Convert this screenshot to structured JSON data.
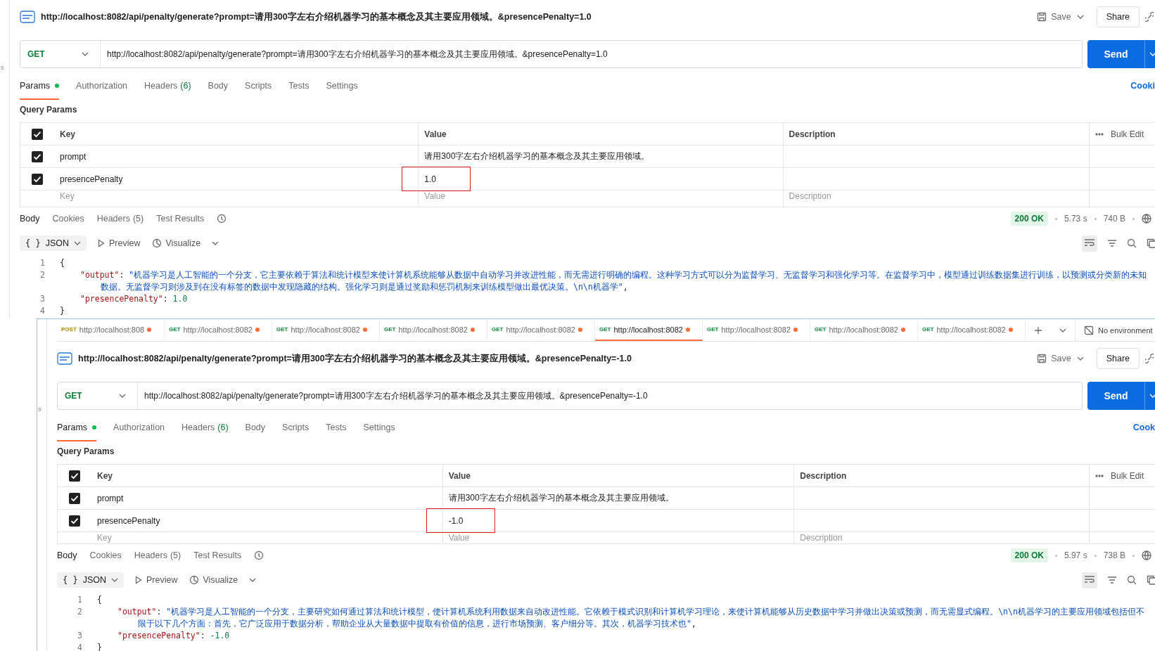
{
  "panels": [
    {
      "edge_text": "s",
      "title": "http://localhost:8082/api/penalty/generate?prompt=请用300字左右介绍机器学习的基本概念及其主要应用领域。&presencePenalty=1.0",
      "save_label": "Save",
      "share_label": "Share",
      "method": "GET",
      "url": "http://localhost:8082/api/penalty/generate?prompt=请用300字左右介绍机器学习的基本概念及其主要应用领域。&presencePenalty=1.0",
      "send_label": "Send",
      "request_tabs": [
        {
          "label": "Params",
          "selected": true,
          "dot": true
        },
        {
          "label": "Authorization",
          "selected": false,
          "dot": false
        },
        {
          "label": "Headers",
          "count": "(6)",
          "selected": false,
          "dot": false
        },
        {
          "label": "Body",
          "selected": false,
          "dot": false
        },
        {
          "label": "Scripts",
          "selected": false,
          "dot": false
        },
        {
          "label": "Tests",
          "selected": false,
          "dot": false
        },
        {
          "label": "Settings",
          "selected": false,
          "dot": false
        }
      ],
      "cookies_link": "Cooki",
      "query_params_label": "Query Params",
      "all_checked": true,
      "columns": [
        "Key",
        "Value",
        "Description"
      ],
      "bulk_edit": "Bulk Edit",
      "params": [
        {
          "checked": true,
          "key": "prompt",
          "value": "请用300字左右介绍机器学习的基本概念及其主要应用领域。",
          "highlighted": false
        },
        {
          "checked": true,
          "key": "presencePenalty",
          "value": "1.0",
          "highlighted": true
        }
      ],
      "placeholder_row": {
        "key": "Key",
        "value": "Value",
        "description": "Description"
      },
      "response_tabs": [
        {
          "label": "Body",
          "selected": true
        },
        {
          "label": "Cookies",
          "selected": false
        },
        {
          "label": "Headers",
          "count": "(5)",
          "selected": false
        },
        {
          "label": "Test Results",
          "selected": false
        }
      ],
      "status": "200 OK",
      "time": "5.73 s",
      "size": "740 B",
      "format_icon": "{ }",
      "format": "JSON",
      "preview_label": "Preview",
      "visualize_label": "Visualize",
      "code_lines": [
        {
          "number": "1",
          "indented": false,
          "tokens": [
            {
              "kind": "punct",
              "text": "{"
            }
          ]
        },
        {
          "number": "2",
          "indented": true,
          "tokens": [
            {
              "kind": "key",
              "text": "\"output\""
            },
            {
              "kind": "punct",
              "text": ": "
            },
            {
              "kind": "string",
              "text": "\"机器学习是人工智能的一个分支，它主要依赖于算法和统计模型来使计算机系统能够从数据中自动学习并改进性能，而无需进行明确的编程。这种学习方式可以分为监督学习、无监督学习和强化学习等。在监督学习中，模型通过训练数据集进行训练，以预测或分类新的未知数据。无监督学习则涉及到在没有标签的数据中发现隐藏的结构。强化学习则是通过奖励和惩罚机制来训练模型做出最优决策。\\n\\n机器学\""
            },
            {
              "kind": "punct",
              "text": ","
            }
          ]
        },
        {
          "number": "3",
          "indented": true,
          "tokens": [
            {
              "kind": "key",
              "text": "\"presencePenalty\""
            },
            {
              "kind": "punct",
              "text": ": "
            },
            {
              "kind": "number",
              "text": "1.0"
            }
          ]
        },
        {
          "number": "4",
          "indented": false,
          "tokens": [
            {
              "kind": "punct",
              "text": "}"
            }
          ]
        }
      ]
    },
    {
      "edge_text": "s",
      "tab_strip": {
        "tabs": [
          {
            "method": "POST",
            "color": "#b7860b",
            "url": "http://localhost:808",
            "modified": true,
            "selected": false
          },
          {
            "method": "GET",
            "color": "#0f8a3c",
            "url": "http://localhost:8082",
            "modified": true,
            "selected": false
          },
          {
            "method": "GET",
            "color": "#0f8a3c",
            "url": "http://localhost:8082",
            "modified": true,
            "selected": false
          },
          {
            "method": "GET",
            "color": "#0f8a3c",
            "url": "http://localhost:8082",
            "modified": true,
            "selected": false
          },
          {
            "method": "GET",
            "color": "#0f8a3c",
            "url": "http://localhost:8082",
            "modified": true,
            "selected": false
          },
          {
            "method": "GET",
            "color": "#0f8a3c",
            "url": "http://localhost:8082",
            "modified": true,
            "selected": true
          },
          {
            "method": "GET",
            "color": "#0f8a3c",
            "url": "http://localhost:8082",
            "modified": true,
            "selected": false
          },
          {
            "method": "GET",
            "color": "#0f8a3c",
            "url": "http://localhost:8082",
            "modified": true,
            "selected": false
          },
          {
            "method": "GET",
            "color": "#0f8a3c",
            "url": "http://localhost:8082",
            "modified": true,
            "selected": false
          }
        ],
        "environment": "No environment"
      },
      "title": "http://localhost:8082/api/penalty/generate?prompt=请用300字左右介绍机器学习的基本概念及其主要应用领域。&presencePenalty=-1.0",
      "save_label": "Save",
      "share_label": "Share",
      "method": "GET",
      "url": "http://localhost:8082/api/penalty/generate?prompt=请用300字左右介绍机器学习的基本概念及其主要应用领域。&presencePenalty=-1.0",
      "send_label": "Send",
      "request_tabs": [
        {
          "label": "Params",
          "selected": true,
          "dot": true
        },
        {
          "label": "Authorization",
          "selected": false,
          "dot": false
        },
        {
          "label": "Headers",
          "count": "(6)",
          "selected": false,
          "dot": false
        },
        {
          "label": "Body",
          "selected": false,
          "dot": false
        },
        {
          "label": "Scripts",
          "selected": false,
          "dot": false
        },
        {
          "label": "Tests",
          "selected": false,
          "dot": false
        },
        {
          "label": "Settings",
          "selected": false,
          "dot": false
        }
      ],
      "cookies_link": "Cook",
      "query_params_label": "Query Params",
      "all_checked": true,
      "columns": [
        "Key",
        "Value",
        "Description"
      ],
      "bulk_edit": "Bulk Edit",
      "params": [
        {
          "checked": true,
          "key": "prompt",
          "value": "请用300字左右介绍机器学习的基本概念及其主要应用领域。",
          "highlighted": false
        },
        {
          "checked": true,
          "key": "presencePenalty",
          "value": "-1.0",
          "highlighted": true
        }
      ],
      "placeholder_row": {
        "key": "Key",
        "value": "Value",
        "description": "Description"
      },
      "response_tabs": [
        {
          "label": "Body",
          "selected": true
        },
        {
          "label": "Cookies",
          "selected": false
        },
        {
          "label": "Headers",
          "count": "(5)",
          "selected": false
        },
        {
          "label": "Test Results",
          "selected": false
        }
      ],
      "status": "200 OK",
      "time": "5.97 s",
      "size": "738 B",
      "format_icon": "{ }",
      "format": "JSON",
      "preview_label": "Preview",
      "visualize_label": "Visualize",
      "code_lines": [
        {
          "number": "1",
          "indented": false,
          "tokens": [
            {
              "kind": "punct",
              "text": "{"
            }
          ]
        },
        {
          "number": "2",
          "indented": true,
          "tokens": [
            {
              "kind": "key",
              "text": "\"output\""
            },
            {
              "kind": "punct",
              "text": ": "
            },
            {
              "kind": "string",
              "text": "\"机器学习是人工智能的一个分支，主要研究如何通过算法和统计模型，使计算机系统利用数据来自动改进性能。它依赖于模式识别和计算机学习理论，来使计算机能够从历史数据中学习并做出决策或预测，而无需显式编程。\\n\\n机器学习的主要应用领域包括但不限于以下几个方面：首先，它广泛应用于数据分析，帮助企业从大量数据中提取有价值的信息，进行市场预测、客户细分等。其次，机器学习技术也\""
            },
            {
              "kind": "punct",
              "text": ","
            }
          ]
        },
        {
          "number": "3",
          "indented": true,
          "tokens": [
            {
              "kind": "key",
              "text": "\"presencePenalty\""
            },
            {
              "kind": "punct",
              "text": ": "
            },
            {
              "kind": "number",
              "text": "-1.0"
            }
          ]
        },
        {
          "number": "4",
          "indented": false,
          "tokens": [
            {
              "kind": "punct",
              "text": "}"
            }
          ]
        }
      ]
    }
  ]
}
